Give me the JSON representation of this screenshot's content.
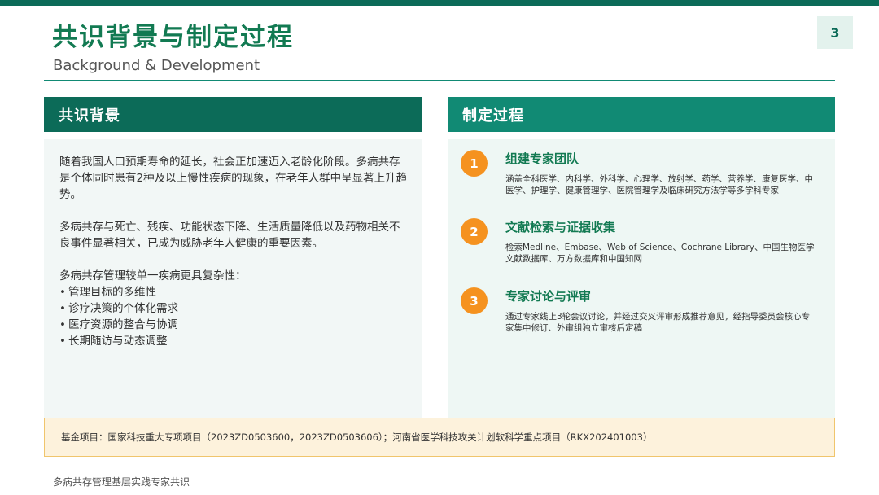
{
  "header": {
    "title": "共识背景与制定过程",
    "subtitle": "Background & Development",
    "page_number": "3"
  },
  "left_panel": {
    "title": "共识背景",
    "para1": "随着我国人口预期寿命的延长，社会正加速迈入老龄化阶段。多病共存是个体同时患有2种及以上慢性疾病的现象，在老年人群中呈显著上升趋势。",
    "para2": "多病共存与死亡、残疾、功能状态下降、生活质量降低以及药物相关不良事件显著相关，已成为威胁老年人健康的重要因素。",
    "list_intro": "多病共存管理较单一疾病更具复杂性：",
    "bullets": [
      "管理目标的多维性",
      "诊疗决策的个体化需求",
      "医疗资源的整合与协调",
      "长期随访与动态调整"
    ]
  },
  "right_panel": {
    "title": "制定过程",
    "steps": [
      {
        "num": "1",
        "title": "组建专家团队",
        "desc": "涵盖全科医学、内科学、外科学、心理学、放射学、药学、营养学、康复医学、中医学、护理学、健康管理学、医院管理学及临床研究方法学等多学科专家"
      },
      {
        "num": "2",
        "title": "文献检索与证据收集",
        "desc": "检索Medline、Embase、Web of Science、Cochrane Library、中国生物医学文献数据库、万方数据库和中国知网"
      },
      {
        "num": "3",
        "title": "专家讨论与评审",
        "desc": "通过专家线上3轮会议讨论，并经过交叉评审形成推荐意见，经指导委员会核心专家集中修订、外审组独立审核后定稿"
      }
    ]
  },
  "funding": "基金项目：国家科技重大专项项目（2023ZD0503600，2023ZD0503606）；河南省医学科技攻关计划软科学重点项目（RKX202401003）",
  "footer": "多病共存管理基层实践专家共识",
  "colors": {
    "primary_green": "#127a52",
    "dark_teal": "#0c6b58",
    "teal": "#118a74",
    "step_orange": "#f5921f",
    "fund_bg": "#fdf2dc",
    "fund_border": "#f0c56c"
  }
}
